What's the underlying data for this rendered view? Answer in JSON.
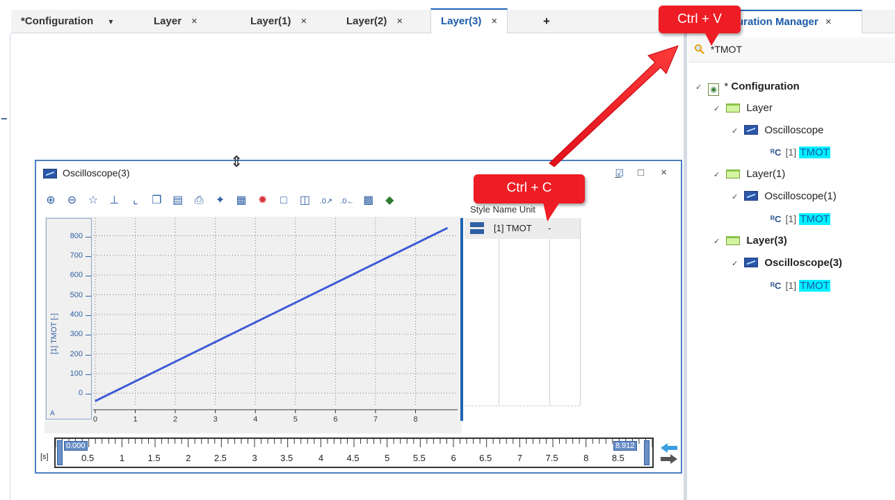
{
  "tabs": [
    {
      "label": "*Configuration",
      "has_menu": true
    },
    {
      "label": "Layer",
      "close": "×"
    },
    {
      "label": "Layer(1)",
      "close": "×"
    },
    {
      "label": "Layer(2)",
      "close": "×"
    },
    {
      "label": "Layer(3)",
      "close": "×",
      "active": true
    }
  ],
  "tab_add": "+",
  "config_manager": {
    "tab_label": "uration Manager",
    "close": "×",
    "search_value": "*TMOT",
    "tree": {
      "root": "Configuration",
      "root_marker": "*",
      "layers": [
        {
          "name": "Layer",
          "oscilloscope": "Oscilloscope",
          "signal_index": "[1]",
          "signal": "TMOT"
        },
        {
          "name": "Layer(1)",
          "oscilloscope": "Oscilloscope(1)",
          "signal_index": "[1]",
          "signal": "TMOT"
        },
        {
          "name": "Layer(3)",
          "oscilloscope": "Oscilloscope(3)",
          "signal_index": "[1]",
          "signal": "TMOT"
        }
      ]
    }
  },
  "oscilloscope": {
    "title": "Oscilloscope(3)",
    "window_controls": "_ □ ×",
    "y_axis_title": "[1] TMOT [-]",
    "y_axis_marker": "A",
    "legend": {
      "header": "Style  Name  Unit",
      "signal_name": "[1] TMOT",
      "signal_unit": "-"
    },
    "time_unit": "[s]",
    "time_start": "0.000",
    "time_end": "8.912",
    "time_ticks": [
      "0.5",
      "1",
      "1.5",
      "2",
      "2.5",
      "3",
      "3.5",
      "4",
      "4.5",
      "5",
      "5.5",
      "6",
      "6.5",
      "7",
      "7.5",
      "8",
      "8.5"
    ]
  },
  "chart_data": {
    "type": "line",
    "title": "",
    "xlabel": "",
    "ylabel": "[1] TMOT [-]",
    "xlim": [
      -0.05,
      9.05
    ],
    "ylim": [
      -70,
      890
    ],
    "x_ticks": [
      "0",
      "1",
      "2",
      "3",
      "4",
      "5",
      "6",
      "7",
      "8"
    ],
    "y_ticks": [
      "0",
      "100",
      "200",
      "300",
      "400",
      "500",
      "600",
      "700",
      "800"
    ],
    "grid": true,
    "series": [
      {
        "name": "[1] TMOT",
        "x": [
          0,
          8.8
        ],
        "y": [
          -40,
          840
        ],
        "color": "#3d5bd6"
      }
    ]
  },
  "callouts": {
    "copy": "Ctrl + C",
    "paste": "Ctrl + V"
  }
}
